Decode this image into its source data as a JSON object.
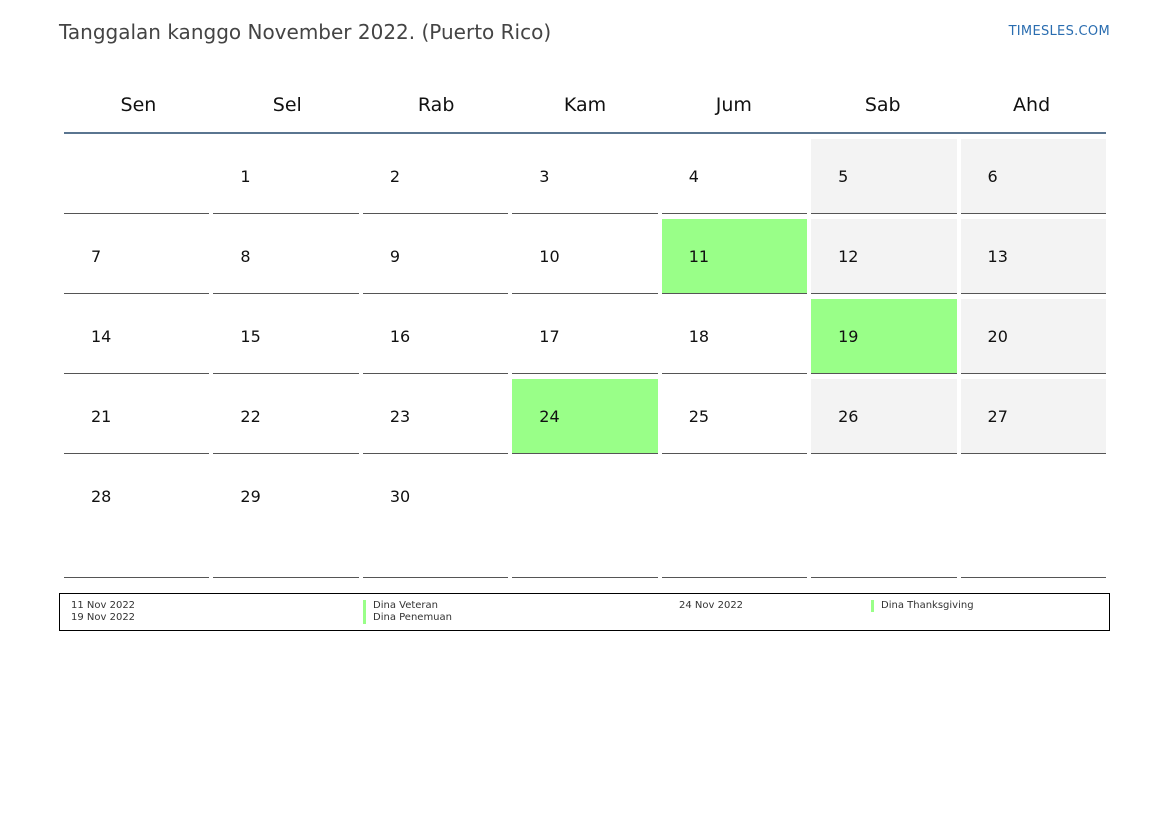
{
  "page": {
    "title": "Tanggalan kanggo November 2022. (Puerto Rico)",
    "site": "TIMESLES.COM"
  },
  "colors": {
    "holiday": "#99ff88",
    "weekend": "#f3f3f3",
    "header_rule": "#5a7590",
    "link": "#2a6db0"
  },
  "calendar": {
    "weekdays": [
      "Sen",
      "Sel",
      "Rab",
      "Kam",
      "Jum",
      "Sab",
      "Ahd"
    ],
    "weeks": [
      [
        "",
        "1",
        "2",
        "3",
        "4",
        "5",
        "6"
      ],
      [
        "7",
        "8",
        "9",
        "10",
        "11",
        "12",
        "13"
      ],
      [
        "14",
        "15",
        "16",
        "17",
        "18",
        "19",
        "20"
      ],
      [
        "21",
        "22",
        "23",
        "24",
        "25",
        "26",
        "27"
      ],
      [
        "28",
        "29",
        "30",
        "",
        "",
        "",
        ""
      ]
    ]
  },
  "holidays": [
    {
      "date": "11 Nov 2022",
      "name": "Dina Veteran"
    },
    {
      "date": "19 Nov 2022",
      "name": "Dina Penemuan"
    },
    {
      "date": "24 Nov 2022",
      "name": "Dina Thanksgiving"
    }
  ]
}
